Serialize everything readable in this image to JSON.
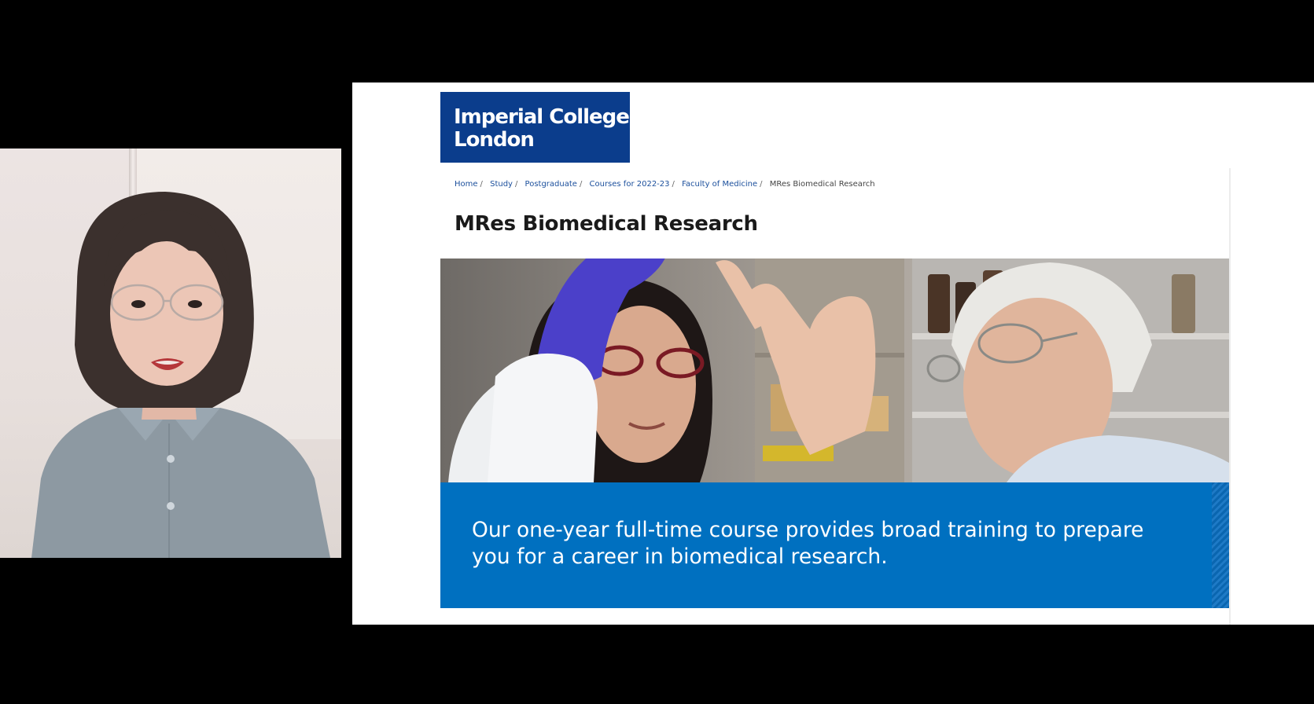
{
  "site": {
    "logo_line1": "Imperial College",
    "logo_line2": "London"
  },
  "breadcrumb": [
    "Home",
    "Study",
    "Postgraduate",
    "Courses for 2022-23",
    "Faculty of Medicine",
    "MRes Biomedical Research"
  ],
  "page_title": "MRes Biomedical Research",
  "hero": {
    "banner_text": "Our one-year full-time course provides broad training to prepare you for a career in biomedical research."
  },
  "colors": {
    "brand_navy": "#0b3d8c",
    "banner_blue": "#0070c0",
    "link_blue": "#1b4f9c"
  }
}
